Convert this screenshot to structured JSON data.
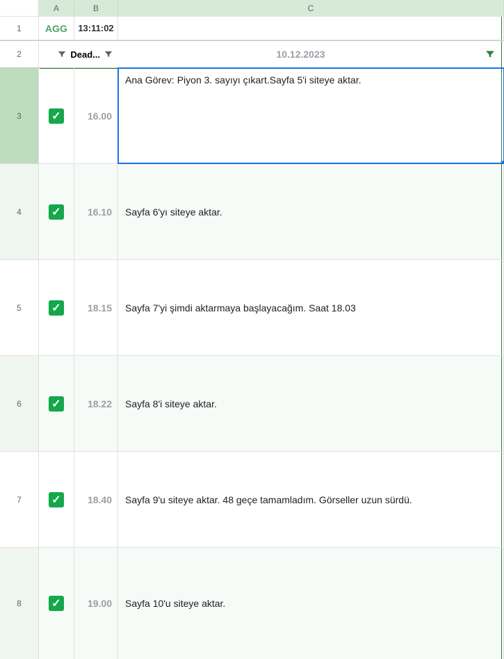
{
  "columns": {
    "A": "A",
    "B": "B",
    "C": "C"
  },
  "row1": {
    "agg": "AGG",
    "time": "13:11:02"
  },
  "row2": {
    "deadLabel": "Dead...",
    "date": "10.12.2023"
  },
  "rows": [
    {
      "num": "3",
      "time": "16.00",
      "text": "Ana Görev: Piyon 3. sayıyı çıkart.Sayfa 5'i siteye aktar."
    },
    {
      "num": "4",
      "time": "16.10",
      "text": "Sayfa 6'yı siteye aktar."
    },
    {
      "num": "5",
      "time": "18.15",
      "text": "Sayfa 7'yi şimdi aktarmaya başlayacağım. Saat 18.03"
    },
    {
      "num": "6",
      "time": "18.22",
      "text": "Sayfa 8'i siteye aktar."
    },
    {
      "num": "7",
      "time": "18.40",
      "text": "Sayfa 9'u siteye aktar. 48 geçe tamamladım. Görseller uzun sürdü."
    },
    {
      "num": "8",
      "time": "19.00",
      "text": "Sayfa 10'u siteye aktar."
    }
  ],
  "rowNums": {
    "r1": "1",
    "r2": "2"
  }
}
